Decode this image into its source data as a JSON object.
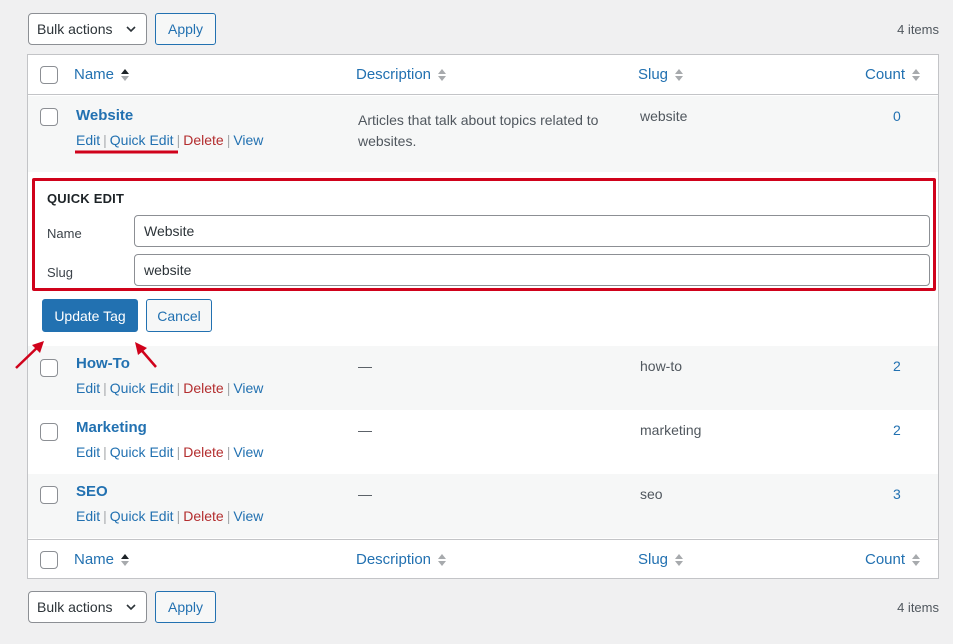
{
  "tablenav": {
    "bulk_label": "Bulk actions",
    "apply_label": "Apply",
    "items_count": "4 items"
  },
  "columns": {
    "name": "Name",
    "description": "Description",
    "slug": "Slug",
    "count": "Count"
  },
  "row_actions": {
    "edit": "Edit",
    "quick_edit": "Quick Edit",
    "delete": "Delete",
    "view": "View",
    "separator": "|"
  },
  "rows": [
    {
      "name": "Website",
      "description_line1": "Articles that talk about topics related to",
      "description_line2": "websites.",
      "slug": "website",
      "count": "0"
    },
    {
      "name": "How-To",
      "description": "—",
      "slug": "how-to",
      "count": "2"
    },
    {
      "name": "Marketing",
      "description": "—",
      "slug": "marketing",
      "count": "2"
    },
    {
      "name": "SEO",
      "description": "—",
      "slug": "seo",
      "count": "3"
    }
  ],
  "quick_edit": {
    "title": "QUICK EDIT",
    "name_label": "Name",
    "name_value": "Website",
    "slug_label": "Slug",
    "slug_value": "website",
    "update_label": "Update Tag",
    "cancel_label": "Cancel"
  },
  "colors": {
    "accent": "#2271b1",
    "delete": "#b32d2e",
    "annotation": "#d0021b"
  }
}
